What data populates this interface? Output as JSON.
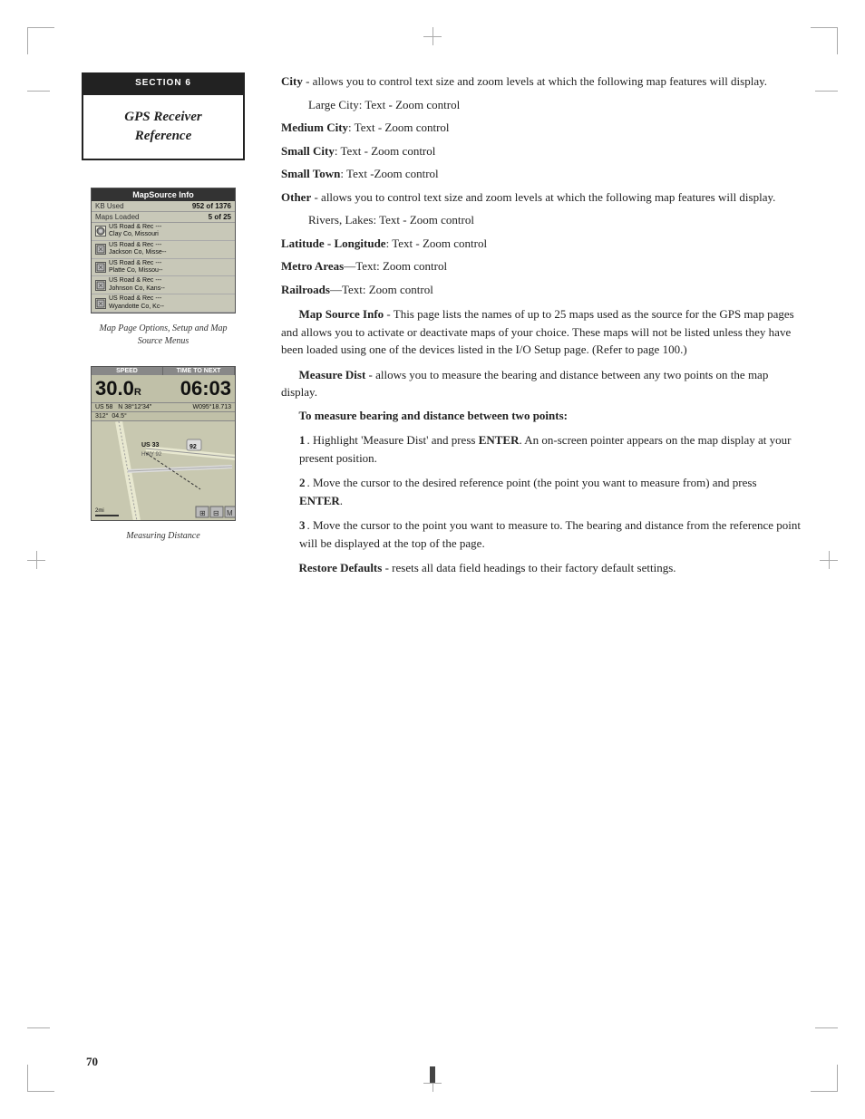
{
  "page": {
    "number": "70",
    "section": {
      "label": "SECTION 6",
      "title_line1": "GPS Receiver",
      "title_line2": "Reference"
    }
  },
  "device1": {
    "title": "MapSource Info",
    "row1_label": "KB Used",
    "row1_value": "952 of 1376",
    "row2_label": "Maps Loaded",
    "row2_value": "5 of 25",
    "items": [
      "US Road & Rec ---  Clay Co, Missouri",
      "US Road & Rec ---  Jackson Co, Misso--",
      "US Road & Rec ---  Platte Co, Missou--",
      "US Road & Rec ---  Johnson Co, Kans--",
      "US Road & Rec ---  Wyandotte Co, Kc--"
    ]
  },
  "caption1": "Map Page Options, Setup and Map Source Menus",
  "device2": {
    "header_col1": "SPEED",
    "header_col2": "TIME TO NEXT",
    "speed_value": "30.0",
    "speed_unit": "R",
    "time_value": "06:03",
    "coord_left": "US 58",
    "coord_right": "N 38°12′34″",
    "coord_left2": "312°",
    "coord_right2": "W095°18.713"
  },
  "caption2": "Measuring Distance",
  "content": {
    "city_heading": "City",
    "city_desc": " -  allows you to control text size and zoom levels at which the following map features will display.",
    "entries": [
      {
        "term": "Large City",
        "desc": ": Text - Zoom control"
      },
      {
        "term": "Medium City",
        "desc": ": Text - Zoom control"
      },
      {
        "term": "Small City",
        "desc": ": Text - Zoom control"
      },
      {
        "term": "Small Town",
        "desc": ": Text -Zoom control"
      }
    ],
    "other_heading": "Other",
    "other_desc": " - allows you to control text size and zoom levels at which the following map features will display.",
    "other_entries": [
      {
        "term": "Rivers, Lakes",
        "desc": ": Text - Zoom control"
      },
      {
        "term": "Latitude - Longitude",
        "desc": ": Text - Zoom control"
      },
      {
        "term": "Metro Areas",
        "desc": "—Text: Zoom control"
      },
      {
        "term": "Railroads",
        "desc": "—Text: Zoom control"
      }
    ],
    "map_source_heading": "Map Source Info",
    "map_source_desc": " - This page lists the names of up to 25 maps used as the source for the GPS map pages and allows you to activate or deactivate maps of your choice. These maps will not be listed unless they have been loaded using one of the devices listed in the I/O Setup page. (Refer to page 100.)",
    "measure_heading": "Measure Dist",
    "measure_desc": " - allows you to measure the bearing and distance between any two points on the map display.",
    "steps_heading": "To measure bearing and distance between two points:",
    "steps": [
      {
        "num": "1",
        "text": ". Highlight 'Measure Dist' and press ENTER. An on-screen pointer appears on the map display at your present position."
      },
      {
        "num": "2",
        "text": ". Move the cursor to the desired reference point (the point you want to measure from) and press ENTER."
      },
      {
        "num": "3",
        "text": ". Move the cursor to the point you want to measure to. The bearing and distance from the reference point will be displayed at the top of the page."
      }
    ],
    "restore_heading": "Restore Defaults",
    "restore_desc": " - resets all data field headings to their factory default settings."
  }
}
